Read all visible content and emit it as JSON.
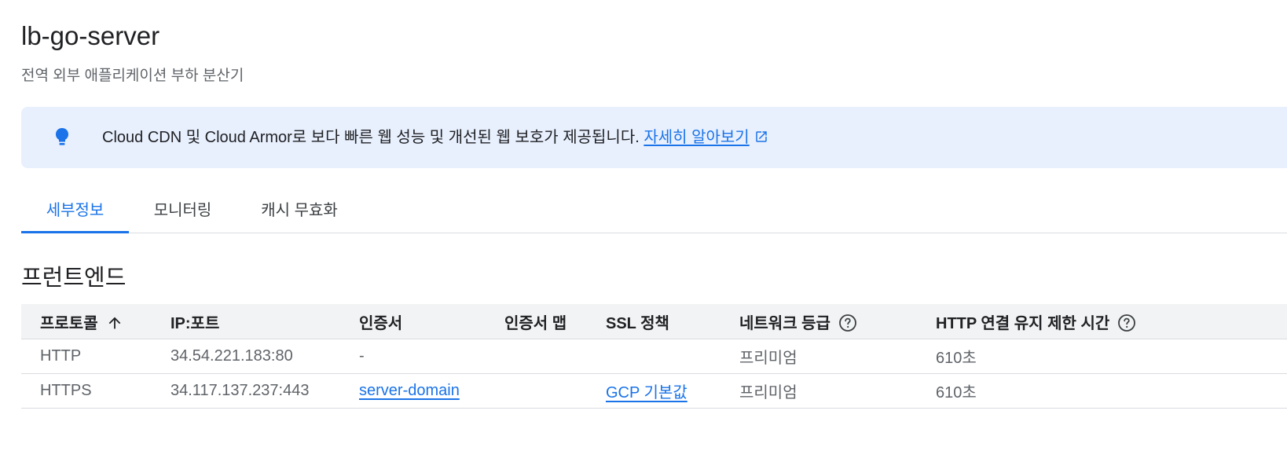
{
  "header": {
    "title": "lb-go-server",
    "subtitle": "전역 외부 애플리케이션 부하 분산기"
  },
  "banner": {
    "icon": "lightbulb-icon",
    "text": "Cloud CDN 및 Cloud Armor로 보다 빠른 웹 성능 및 개선된 웹 보호가 제공됩니다. ",
    "link_label": "자세히 알아보기",
    "link_icon": "open-in-new-icon",
    "background": "#e8f0fe"
  },
  "tabs": [
    {
      "label": "세부정보",
      "active": true
    },
    {
      "label": "모니터링",
      "active": false
    },
    {
      "label": "캐시 무효화",
      "active": false
    }
  ],
  "frontend": {
    "section_title": "프런트엔드",
    "columns": {
      "protocol": "프로토콜",
      "ip_port": "IP:포트",
      "certificate": "인증서",
      "cert_map": "인증서 맵",
      "ssl_policy": "SSL 정책",
      "network_tier": "네트워크 등급",
      "http_keepalive": "HTTP 연결 유지 제한 시간"
    },
    "rows": [
      {
        "protocol": "HTTP",
        "ip_port": "34.54.221.183:80",
        "certificate": "-",
        "cert_map": "",
        "ssl_policy": "",
        "network_tier": "프리미엄",
        "http_keepalive": "610초"
      },
      {
        "protocol": "HTTPS",
        "ip_port": "34.117.137.237:443",
        "certificate": "server-domain",
        "cert_map": "",
        "ssl_policy": "GCP 기본값",
        "network_tier": "프리미엄",
        "http_keepalive": "610초"
      }
    ]
  },
  "colors": {
    "accent": "#1a73e8",
    "text_primary": "#202124",
    "text_secondary": "#5f6368"
  }
}
